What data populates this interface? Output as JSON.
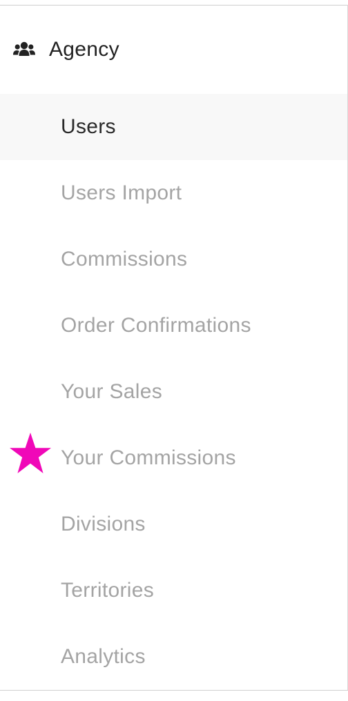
{
  "colors": {
    "active_bg": "#f8f8f8",
    "active_text": "#2a2a2a",
    "inactive_text": "#a4a4a4",
    "header_text": "#222222",
    "star_marker": "#f008b8"
  },
  "section": {
    "icon": "users-group-icon",
    "title": "Agency"
  },
  "menu": {
    "items": [
      {
        "label": "Users",
        "active": true
      },
      {
        "label": "Users Import",
        "active": false
      },
      {
        "label": "Commissions",
        "active": false
      },
      {
        "label": "Order Confirmations",
        "active": false
      },
      {
        "label": "Your Sales",
        "active": false
      },
      {
        "label": "Your Commissions",
        "active": false,
        "marker": "star-icon"
      },
      {
        "label": "Divisions",
        "active": false
      },
      {
        "label": "Territories",
        "active": false
      },
      {
        "label": "Analytics",
        "active": false
      }
    ]
  }
}
